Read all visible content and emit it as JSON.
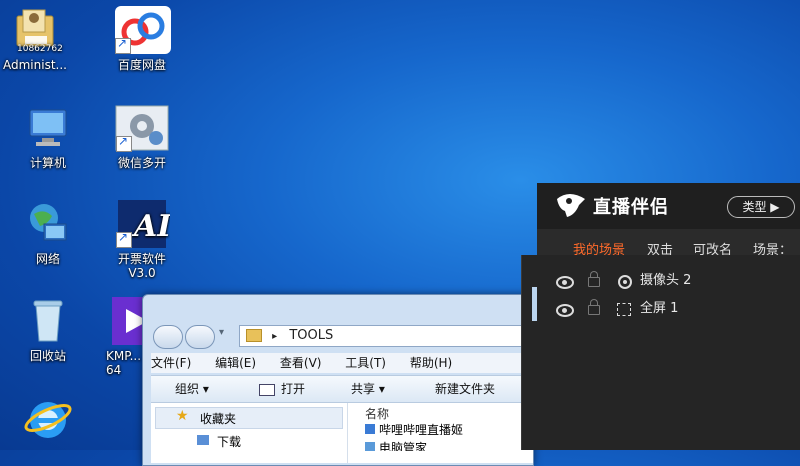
{
  "desktop": {
    "icons": [
      {
        "label": "Administ...",
        "sublabel": "10862762"
      },
      {
        "label": "百度网盘"
      },
      {
        "label": "计算机"
      },
      {
        "label": "微信多开"
      },
      {
        "label": "网络"
      },
      {
        "label": "开票软件\nV3.0"
      },
      {
        "label": "回收站"
      },
      {
        "label": "KMP...\n64"
      }
    ]
  },
  "explorer": {
    "path": "TOOLS",
    "menu": [
      "文件(F)",
      "编辑(E)",
      "查看(V)",
      "工具(T)",
      "帮助(H)"
    ],
    "toolbar": {
      "organize": "组织 ▾",
      "open": "打开",
      "share": "共享 ▾",
      "new_folder": "新建文件夹"
    },
    "nav": {
      "favorites": "收藏夹",
      "downloads": "下载"
    },
    "files": {
      "header": "名称",
      "item1": "哔哩哔哩直播姬",
      "item2": "电脑管家"
    }
  },
  "stream": {
    "brand": "直播伴侣",
    "type_button": "类型 ▶",
    "tabs": [
      "我的场景",
      "双击",
      "可改名",
      "场景："
    ],
    "scenes": [
      {
        "label": "摄像头 2"
      },
      {
        "label": "全屏 1"
      }
    ],
    "colors": {
      "accent": "#ff6a2a",
      "panel": "#2b2b2b"
    }
  }
}
